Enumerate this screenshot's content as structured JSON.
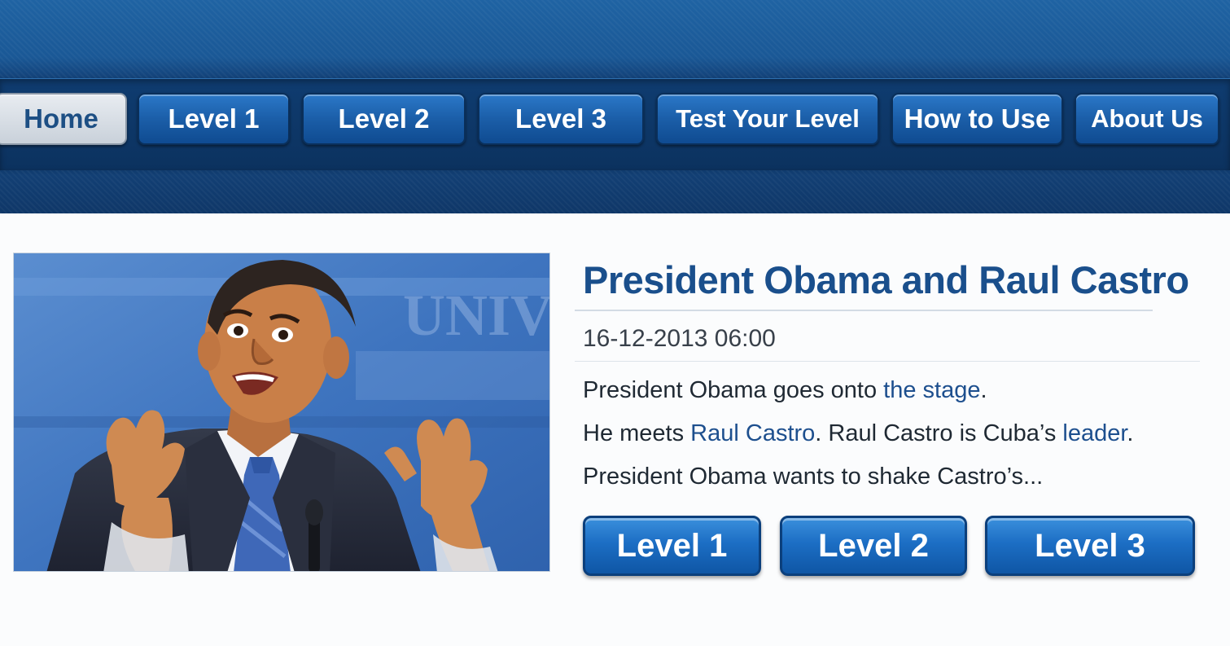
{
  "nav": {
    "items": [
      {
        "label": "Home",
        "active": true
      },
      {
        "label": "Level 1"
      },
      {
        "label": "Level 2"
      },
      {
        "label": "Level 3"
      },
      {
        "label": "Test Your Level"
      },
      {
        "label": "How to Use"
      },
      {
        "label": "About Us"
      }
    ]
  },
  "article": {
    "title": "President Obama and Raul Castro",
    "date": "16-12-2013 06:00",
    "lines": [
      {
        "pre": "President Obama goes onto ",
        "link": "the stage",
        "post": "."
      },
      {
        "pre": "He meets ",
        "link": "Raul Castro",
        "mid": ". Raul Castro is Cuba’s ",
        "link2": "leader",
        "post": "."
      },
      {
        "pre": "President Obama wants to shake Castro’s..."
      }
    ],
    "image": {
      "backdrop_text": "UNIV"
    },
    "level_buttons": [
      "Level 1",
      "Level 2",
      "Level 3"
    ]
  },
  "colors": {
    "header_blue": "#1a5896",
    "nav_band": "#0f3a6c",
    "title_blue": "#1a4f8c",
    "link_blue": "#1d4f8e",
    "button_blue": "#1c6ec4"
  }
}
